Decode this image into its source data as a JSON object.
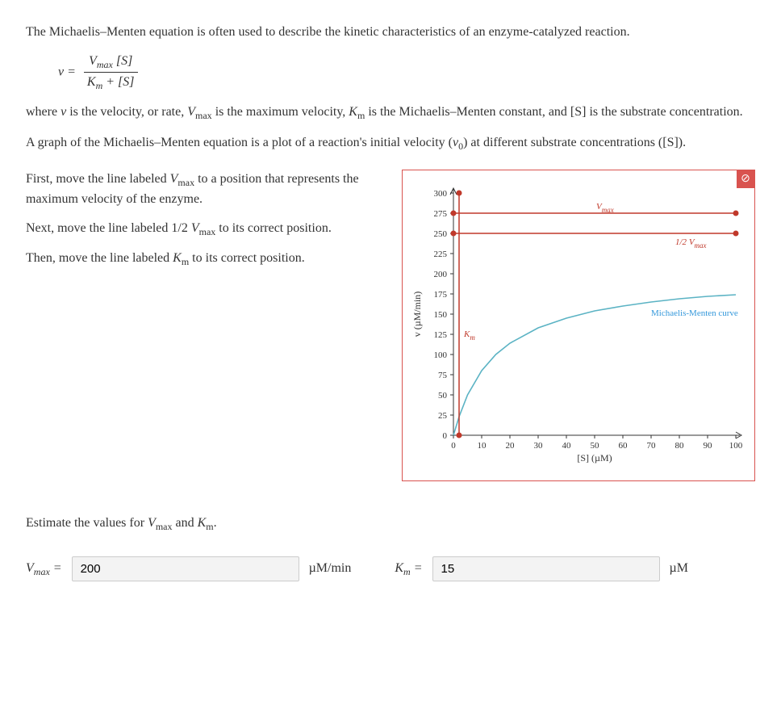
{
  "intro": "The Michaelis–Menten equation is often used to describe the kinetic characteristics of an enzyme-catalyzed reaction.",
  "equation": {
    "lhs": "v =",
    "numerator": "Vmax [S]",
    "denominator": "Km + [S]"
  },
  "where_text": "where v is the velocity, or rate, Vmax is the maximum velocity, Km is the Michaelis–Menten constant, and [S] is the substrate concentration.",
  "graph_desc": "A graph of the Michaelis–Menten equation is a plot of a reaction's initial velocity (v0) at different substrate concentrations ([S]).",
  "instructions": {
    "line1": "First, move the line labeled Vmax to a position that represents the maximum velocity of the enzyme.",
    "line2": "Next, move the line labeled 1/2 Vmax to its correct position.",
    "line3": "Then, move the line labeled Km to its correct position."
  },
  "reset_icon": "⊘",
  "estimate_prompt": "Estimate the values for Vmax and Km.",
  "inputs": {
    "vmax_label": "Vmax =",
    "vmax_value": "200",
    "vmax_unit": "µM/min",
    "km_label": "Km =",
    "km_value": "15",
    "km_unit": "µM"
  },
  "chart_data": {
    "type": "line",
    "xlabel": "[S] (µM)",
    "ylabel": "v (µM/min)",
    "xlim": [
      0,
      100
    ],
    "ylim": [
      0,
      300
    ],
    "x_ticks": [
      0,
      10,
      20,
      30,
      40,
      50,
      60,
      70,
      80,
      90,
      100
    ],
    "y_ticks": [
      0,
      25,
      50,
      75,
      100,
      125,
      150,
      175,
      200,
      225,
      250,
      275,
      300
    ],
    "series": [
      {
        "name": "Michaelis-Menten curve",
        "color": "#5bb3c4",
        "x": [
          0,
          2,
          5,
          10,
          15,
          20,
          30,
          40,
          50,
          60,
          70,
          80,
          90,
          100
        ],
        "y": [
          0,
          23,
          50,
          80,
          100,
          114,
          133,
          145,
          154,
          160,
          165,
          169,
          172,
          174
        ]
      }
    ],
    "markers": {
      "Vmax_line_y": 275,
      "half_Vmax_line_y": 250,
      "Km_line_x": 2
    },
    "annotations": {
      "vmax": "Vmax",
      "half_vmax": "1/2 Vmax",
      "km": "Km",
      "curve": "Michaelis-Menten curve"
    }
  }
}
